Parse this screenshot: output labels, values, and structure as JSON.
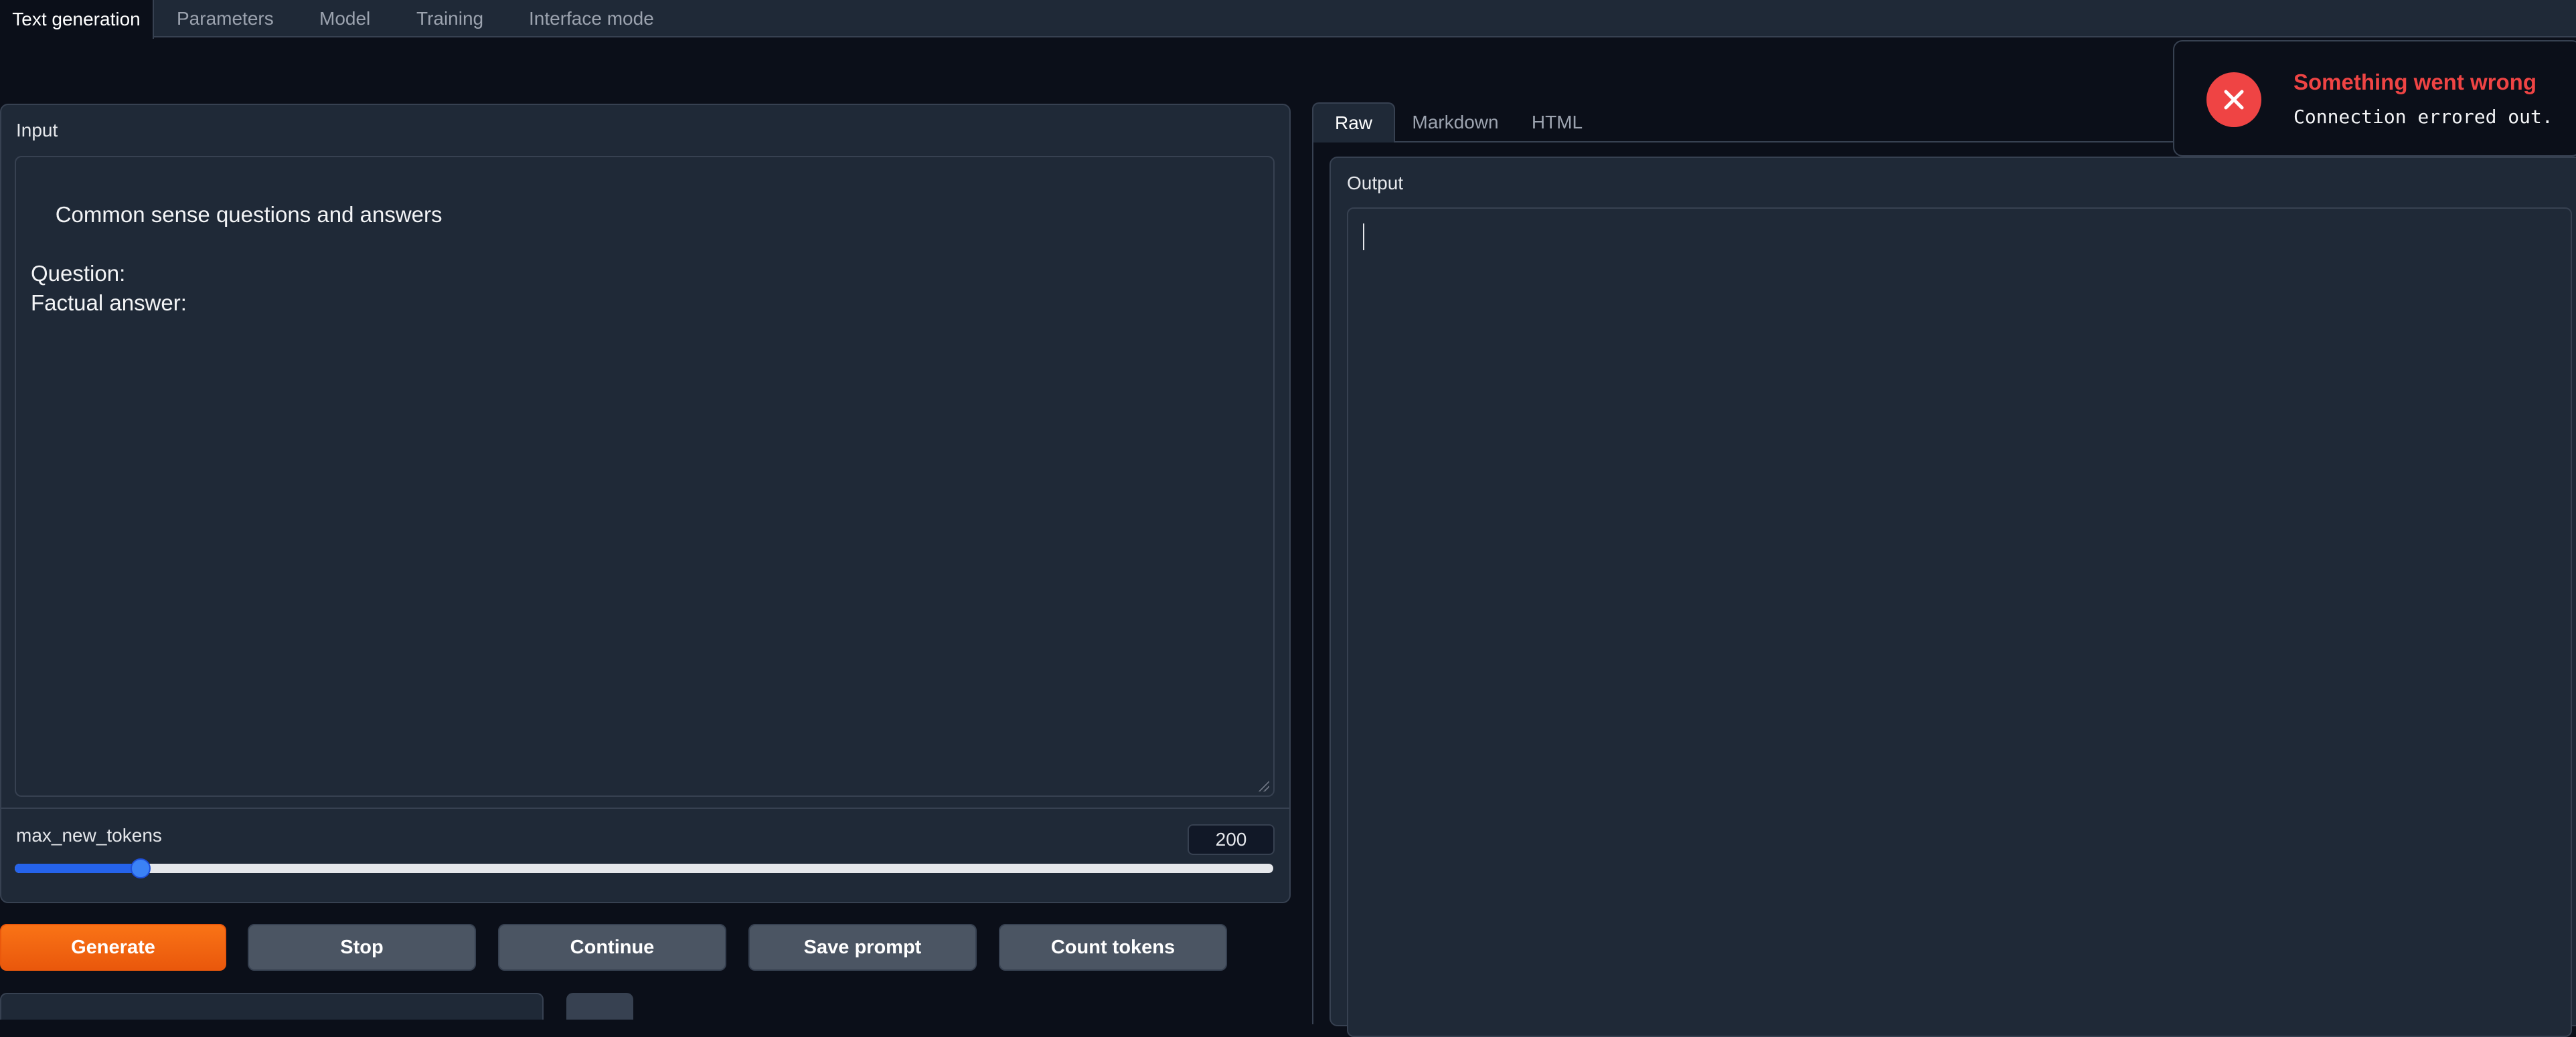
{
  "top_tabs": [
    {
      "label": "Text generation",
      "active": true
    },
    {
      "label": "Parameters",
      "active": false
    },
    {
      "label": "Model",
      "active": false
    },
    {
      "label": "Training",
      "active": false
    },
    {
      "label": "Interface mode",
      "active": false
    }
  ],
  "input": {
    "label": "Input",
    "text": "Common sense questions and answers\n\nQuestion:\nFactual answer:"
  },
  "max_new_tokens": {
    "label": "max_new_tokens",
    "value": "200",
    "min": 0,
    "max": 2000,
    "fraction": 0.1
  },
  "buttons": {
    "generate": "Generate",
    "stop": "Stop",
    "continue": "Continue",
    "save_prompt": "Save prompt",
    "count_tokens": "Count tokens"
  },
  "output_tabs": [
    {
      "label": "Raw",
      "active": true
    },
    {
      "label": "Markdown",
      "active": false
    },
    {
      "label": "HTML",
      "active": false
    }
  ],
  "output": {
    "label": "Output",
    "text": ""
  },
  "toast": {
    "title": "Something went wrong",
    "message": "Connection errored out.",
    "icon": "close-circle-icon"
  },
  "colors": {
    "background": "#0b0f19",
    "panel": "#1f2937",
    "border": "#374151",
    "accent_orange": "#f97316",
    "slider_blue": "#2563eb",
    "error_red": "#ef4444"
  }
}
